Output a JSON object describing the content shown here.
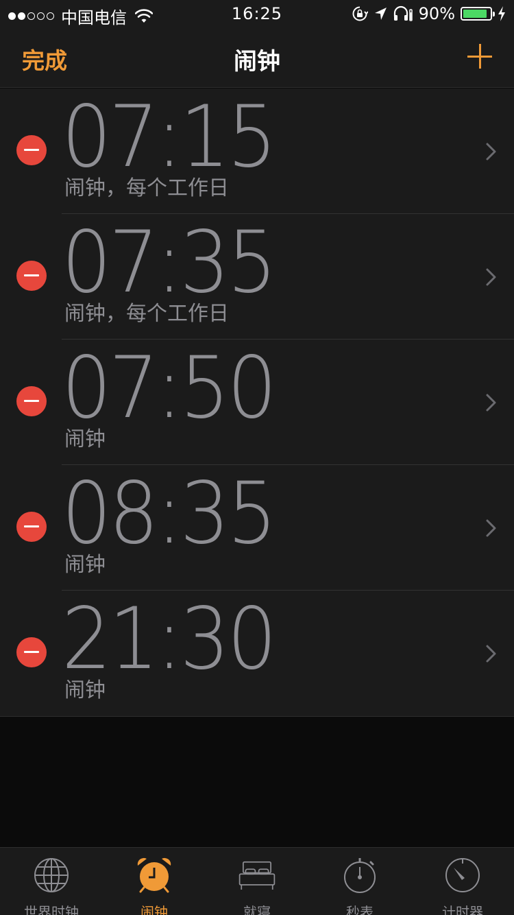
{
  "status_bar": {
    "carrier": "中国电信",
    "time": "16:25",
    "battery_percent": "90%",
    "battery_level": 0.9,
    "signal_bars_filled": 2,
    "signal_bars_total": 5
  },
  "nav": {
    "done_label": "完成",
    "title": "闹钟"
  },
  "alarms": [
    {
      "time": "07:15",
      "label": "闹钟，每个工作日"
    },
    {
      "time": "07:35",
      "label": "闹钟，每个工作日"
    },
    {
      "time": "07:50",
      "label": "闹钟"
    },
    {
      "time": "08:35",
      "label": "闹钟"
    },
    {
      "time": "21:30",
      "label": "闹钟"
    }
  ],
  "tabs": [
    {
      "label": "世界时钟",
      "icon": "globe-icon",
      "active": false
    },
    {
      "label": "闹钟",
      "icon": "alarm-clock-icon",
      "active": true
    },
    {
      "label": "就寝",
      "icon": "bed-icon",
      "active": false
    },
    {
      "label": "秒表",
      "icon": "stopwatch-icon",
      "active": false
    },
    {
      "label": "计时器",
      "icon": "timer-icon",
      "active": false
    }
  ],
  "colors": {
    "accent": "#f09a37",
    "delete": "#e7473c",
    "battery": "#4cd964",
    "text_secondary": "#8e8e93"
  }
}
